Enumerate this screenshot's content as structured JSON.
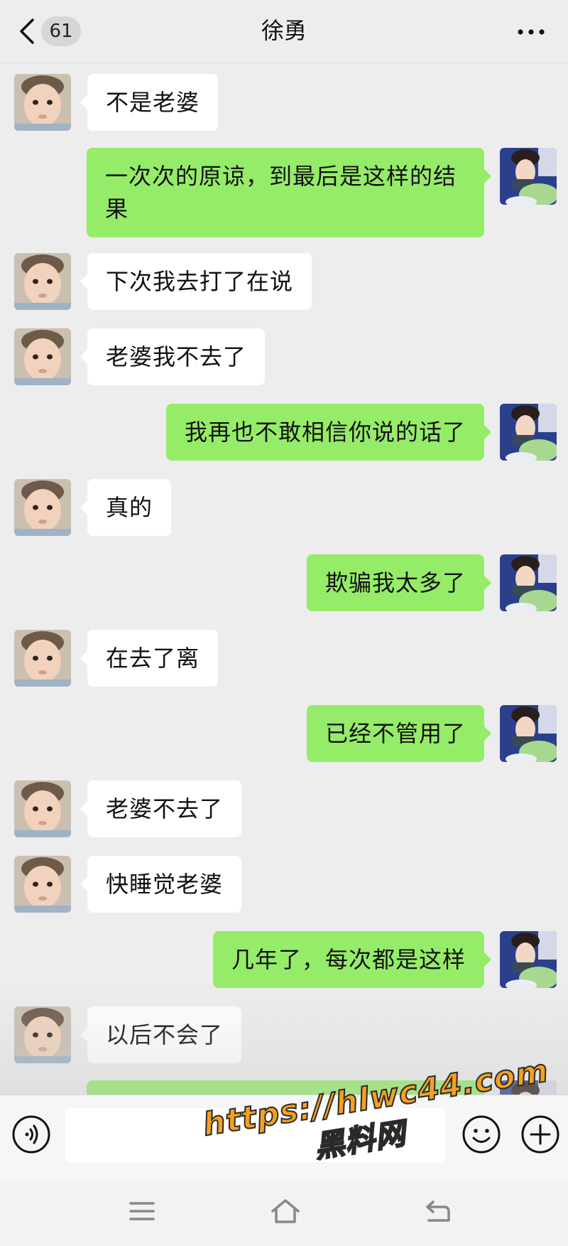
{
  "header": {
    "title": "徐勇",
    "unread_count": "61",
    "back_icon": "chevron-left-icon",
    "more_icon": "more-dots-icon"
  },
  "messages": [
    {
      "side": "in",
      "text": "不是老婆"
    },
    {
      "side": "out",
      "text": "一次次的原谅，到最后是这样的结果"
    },
    {
      "side": "in",
      "text": "下次我去打了在说"
    },
    {
      "side": "in",
      "text": "老婆我不去了"
    },
    {
      "side": "out",
      "text": "我再也不敢相信你说的话了"
    },
    {
      "side": "in",
      "text": "真的"
    },
    {
      "side": "out",
      "text": "欺骗我太多了"
    },
    {
      "side": "in",
      "text": "在去了离"
    },
    {
      "side": "out",
      "text": "已经不管用了"
    },
    {
      "side": "in",
      "text": "老婆不去了"
    },
    {
      "side": "in",
      "text": "快睡觉老婆"
    },
    {
      "side": "out",
      "text": "几年了，每次都是这样"
    },
    {
      "side": "in",
      "text": "以后不会了"
    },
    {
      "side": "out",
      "text": ""
    }
  ],
  "input_bar": {
    "voice_icon": "voice-icon",
    "emoji_icon": "emoji-icon",
    "plus_icon": "plus-circle-icon",
    "input_value": ""
  },
  "nav_bar": {
    "menu_icon": "menu-icon",
    "home_icon": "home-icon",
    "back_icon": "back-arrow-icon"
  },
  "watermark": {
    "url": "https://hlwc44.com",
    "name": "黑料网"
  },
  "colors": {
    "background": "#ededed",
    "outgoing_bubble": "#95ec69",
    "incoming_bubble": "#ffffff",
    "watermark": "#f5a020"
  }
}
